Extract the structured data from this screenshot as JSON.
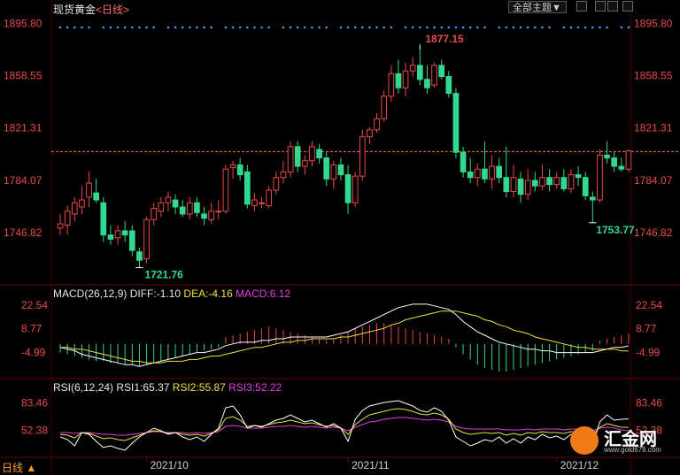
{
  "header": {
    "instrument": "现货黄金",
    "period_control": "<日线>"
  },
  "toolbar": {
    "theme_label": "全部主题▼"
  },
  "bottom": {
    "period_label": "日线 ▲"
  },
  "logo": {
    "text": "汇金网",
    "url": "www.gold678.com"
  },
  "colors": {
    "up": "#e84a4a",
    "down": "#30d890",
    "grid": "#3a0000",
    "axis_text_red": "#e84a4a",
    "diff": "#ffffff",
    "dea": "#f0e040",
    "rsi3": "#e040e0"
  },
  "chart_data": [
    {
      "type": "candlestick",
      "panel": "price",
      "yticks": [
        1895.8,
        1858.55,
        1821.31,
        1784.07,
        1746.82
      ],
      "ylim": [
        1712,
        1900
      ],
      "annotations": [
        {
          "label": "1877.15",
          "color": "#e84a4a"
        },
        {
          "label": "1721.76",
          "color": "#30d890"
        },
        {
          "label": "1753.77",
          "color": "#30d890"
        }
      ],
      "reference_line": 1804.5,
      "candles": [
        {
          "o": 1750,
          "h": 1760,
          "l": 1745,
          "c": 1753
        },
        {
          "o": 1752,
          "h": 1766,
          "l": 1745,
          "c": 1762
        },
        {
          "o": 1760,
          "h": 1772,
          "l": 1755,
          "c": 1768
        },
        {
          "o": 1765,
          "h": 1780,
          "l": 1760,
          "c": 1770
        },
        {
          "o": 1772,
          "h": 1790,
          "l": 1765,
          "c": 1782
        },
        {
          "o": 1775,
          "h": 1785,
          "l": 1768,
          "c": 1770
        },
        {
          "o": 1768,
          "h": 1772,
          "l": 1740,
          "c": 1745
        },
        {
          "o": 1745,
          "h": 1752,
          "l": 1738,
          "c": 1742
        },
        {
          "o": 1743,
          "h": 1752,
          "l": 1738,
          "c": 1748
        },
        {
          "o": 1748,
          "h": 1755,
          "l": 1740,
          "c": 1745
        },
        {
          "o": 1748,
          "h": 1752,
          "l": 1730,
          "c": 1734
        },
        {
          "o": 1733,
          "h": 1736,
          "l": 1721.76,
          "c": 1727
        },
        {
          "o": 1728,
          "h": 1758,
          "l": 1725,
          "c": 1756
        },
        {
          "o": 1756,
          "h": 1768,
          "l": 1752,
          "c": 1764
        },
        {
          "o": 1762,
          "h": 1772,
          "l": 1758,
          "c": 1768
        },
        {
          "o": 1768,
          "h": 1776,
          "l": 1762,
          "c": 1772
        },
        {
          "o": 1770,
          "h": 1774,
          "l": 1760,
          "c": 1765
        },
        {
          "o": 1765,
          "h": 1770,
          "l": 1758,
          "c": 1760
        },
        {
          "o": 1760,
          "h": 1772,
          "l": 1756,
          "c": 1768
        },
        {
          "o": 1768,
          "h": 1772,
          "l": 1758,
          "c": 1761
        },
        {
          "o": 1760,
          "h": 1765,
          "l": 1752,
          "c": 1757
        },
        {
          "o": 1756,
          "h": 1768,
          "l": 1753,
          "c": 1762
        },
        {
          "o": 1762,
          "h": 1770,
          "l": 1756,
          "c": 1762
        },
        {
          "o": 1762,
          "h": 1795,
          "l": 1760,
          "c": 1792
        },
        {
          "o": 1793,
          "h": 1798,
          "l": 1785,
          "c": 1795
        },
        {
          "o": 1795,
          "h": 1800,
          "l": 1784,
          "c": 1788
        },
        {
          "o": 1790,
          "h": 1795,
          "l": 1764,
          "c": 1767
        },
        {
          "o": 1766,
          "h": 1775,
          "l": 1762,
          "c": 1770
        },
        {
          "o": 1768,
          "h": 1772,
          "l": 1764,
          "c": 1768
        },
        {
          "o": 1766,
          "h": 1780,
          "l": 1764,
          "c": 1777
        },
        {
          "o": 1777,
          "h": 1790,
          "l": 1774,
          "c": 1786
        },
        {
          "o": 1786,
          "h": 1798,
          "l": 1782,
          "c": 1790
        },
        {
          "o": 1790,
          "h": 1812,
          "l": 1786,
          "c": 1808
        },
        {
          "o": 1808,
          "h": 1812,
          "l": 1790,
          "c": 1794
        },
        {
          "o": 1794,
          "h": 1802,
          "l": 1788,
          "c": 1798
        },
        {
          "o": 1798,
          "h": 1812,
          "l": 1794,
          "c": 1808
        },
        {
          "o": 1806,
          "h": 1810,
          "l": 1796,
          "c": 1800
        },
        {
          "o": 1800,
          "h": 1804,
          "l": 1780,
          "c": 1785
        },
        {
          "o": 1785,
          "h": 1798,
          "l": 1778,
          "c": 1795
        },
        {
          "o": 1795,
          "h": 1800,
          "l": 1784,
          "c": 1788
        },
        {
          "o": 1788,
          "h": 1795,
          "l": 1760,
          "c": 1768
        },
        {
          "o": 1768,
          "h": 1790,
          "l": 1765,
          "c": 1787
        },
        {
          "o": 1787,
          "h": 1820,
          "l": 1784,
          "c": 1815
        },
        {
          "o": 1815,
          "h": 1822,
          "l": 1810,
          "c": 1820
        },
        {
          "o": 1820,
          "h": 1832,
          "l": 1818,
          "c": 1828
        },
        {
          "o": 1828,
          "h": 1848,
          "l": 1826,
          "c": 1844
        },
        {
          "o": 1844,
          "h": 1866,
          "l": 1840,
          "c": 1860
        },
        {
          "o": 1860,
          "h": 1870,
          "l": 1846,
          "c": 1850
        },
        {
          "o": 1850,
          "h": 1868,
          "l": 1844,
          "c": 1862
        },
        {
          "o": 1862,
          "h": 1872,
          "l": 1858,
          "c": 1866
        },
        {
          "o": 1866,
          "h": 1877.15,
          "l": 1852,
          "c": 1856
        },
        {
          "o": 1856,
          "h": 1866,
          "l": 1846,
          "c": 1850
        },
        {
          "o": 1852,
          "h": 1868,
          "l": 1850,
          "c": 1866
        },
        {
          "o": 1866,
          "h": 1870,
          "l": 1856,
          "c": 1858
        },
        {
          "o": 1858,
          "h": 1862,
          "l": 1843,
          "c": 1846
        },
        {
          "o": 1846,
          "h": 1850,
          "l": 1800,
          "c": 1804
        },
        {
          "o": 1804,
          "h": 1808,
          "l": 1786,
          "c": 1790
        },
        {
          "o": 1790,
          "h": 1800,
          "l": 1782,
          "c": 1786
        },
        {
          "o": 1786,
          "h": 1796,
          "l": 1780,
          "c": 1792
        },
        {
          "o": 1792,
          "h": 1812,
          "l": 1782,
          "c": 1785
        },
        {
          "o": 1785,
          "h": 1802,
          "l": 1778,
          "c": 1794
        },
        {
          "o": 1794,
          "h": 1800,
          "l": 1782,
          "c": 1786
        },
        {
          "o": 1786,
          "h": 1808,
          "l": 1772,
          "c": 1776
        },
        {
          "o": 1776,
          "h": 1795,
          "l": 1772,
          "c": 1786
        },
        {
          "o": 1785,
          "h": 1790,
          "l": 1768,
          "c": 1774
        },
        {
          "o": 1774,
          "h": 1792,
          "l": 1770,
          "c": 1784
        },
        {
          "o": 1784,
          "h": 1790,
          "l": 1776,
          "c": 1780
        },
        {
          "o": 1780,
          "h": 1795,
          "l": 1777,
          "c": 1786
        },
        {
          "o": 1786,
          "h": 1792,
          "l": 1776,
          "c": 1781
        },
        {
          "o": 1781,
          "h": 1790,
          "l": 1778,
          "c": 1786
        },
        {
          "o": 1786,
          "h": 1792,
          "l": 1776,
          "c": 1778
        },
        {
          "o": 1778,
          "h": 1792,
          "l": 1775,
          "c": 1788
        },
        {
          "o": 1788,
          "h": 1794,
          "l": 1780,
          "c": 1786
        },
        {
          "o": 1786,
          "h": 1790,
          "l": 1770,
          "c": 1773
        },
        {
          "o": 1772,
          "h": 1776,
          "l": 1753.77,
          "c": 1770
        },
        {
          "o": 1770,
          "h": 1806,
          "l": 1768,
          "c": 1802
        },
        {
          "o": 1802,
          "h": 1812,
          "l": 1796,
          "c": 1800
        },
        {
          "o": 1800,
          "h": 1804,
          "l": 1790,
          "c": 1794
        },
        {
          "o": 1794,
          "h": 1800,
          "l": 1790,
          "c": 1792
        },
        {
          "o": 1792,
          "h": 1806,
          "l": 1790,
          "c": 1805
        }
      ],
      "markers_on_top": true
    },
    {
      "type": "bar+line",
      "panel": "macd",
      "title": "MACD(26,12,9)",
      "diff_label": "DIFF:-1.10",
      "dea_label": "DEA:-4.16",
      "macd_label": "MACD:6.12",
      "yticks": [
        22.54,
        8.77,
        -4.99
      ],
      "ylim": [
        -18,
        26
      ],
      "macd_hist": [
        -5,
        -6,
        -7,
        -8,
        -9,
        -10,
        -10,
        -11,
        -11,
        -12,
        -12,
        -13,
        -12,
        -11,
        -10,
        -9,
        -8,
        -7,
        -6,
        -5,
        -4,
        -3,
        -2,
        4,
        5,
        6,
        7,
        8,
        9,
        10,
        9,
        8,
        7,
        6,
        5,
        4,
        3,
        2,
        3,
        5,
        7,
        9,
        10,
        11,
        12,
        12,
        11,
        10,
        9,
        8,
        7,
        6,
        5,
        4,
        3,
        -2,
        -6,
        -9,
        -12,
        -14,
        -15,
        -16,
        -16,
        -15,
        -14,
        -13,
        -12,
        -11,
        -10,
        -9,
        -8,
        -7,
        -6,
        -5,
        -4,
        2,
        3,
        4,
        5,
        6
      ],
      "diff": [
        -2,
        -3,
        -4,
        -6,
        -7,
        -8,
        -9,
        -10,
        -11,
        -12,
        -12,
        -13,
        -12,
        -11,
        -10,
        -9,
        -8,
        -7,
        -6,
        -5,
        -5,
        -4,
        -3,
        -1,
        0,
        1,
        1,
        1,
        2,
        2,
        3,
        3,
        4,
        4,
        4,
        4,
        4,
        4,
        5,
        6,
        7,
        9,
        11,
        13,
        15,
        17,
        19,
        21,
        22,
        23,
        23,
        23,
        22,
        21,
        20,
        17,
        13,
        10,
        7,
        5,
        3,
        1,
        0,
        -1,
        -2,
        -3,
        -3,
        -4,
        -4,
        -5,
        -5,
        -5,
        -5,
        -5,
        -5,
        -4,
        -3,
        -2,
        -2,
        -1.1
      ],
      "dea": [
        -2,
        -2,
        -3,
        -3,
        -4,
        -5,
        -6,
        -7,
        -8,
        -9,
        -10,
        -10,
        -11,
        -11,
        -11,
        -10,
        -10,
        -10,
        -9,
        -9,
        -8,
        -7,
        -7,
        -6,
        -5,
        -4,
        -3,
        -2,
        -2,
        -1,
        0,
        1,
        1,
        2,
        2,
        3,
        3,
        3,
        3,
        4,
        4,
        5,
        6,
        7,
        8,
        9,
        11,
        12,
        14,
        15,
        16,
        17,
        18,
        19,
        19,
        19,
        18,
        17,
        16,
        14,
        13,
        11,
        10,
        8,
        7,
        6,
        4,
        3,
        2,
        1,
        0,
        -1,
        -2,
        -2,
        -3,
        -3,
        -3,
        -3,
        -4,
        -4.16
      ]
    },
    {
      "type": "line",
      "panel": "rsi",
      "title": "RSI(6,12,24)",
      "rsi1_label": "RSI1:65.37",
      "rsi2_label": "RSI2:55.87",
      "rsi3_label": "RSI3:52.22",
      "yticks": [
        83.46,
        52.38
      ],
      "ylim": [
        25,
        95
      ],
      "rsi1": [
        45,
        42,
        35,
        50,
        48,
        40,
        33,
        35,
        32,
        30,
        38,
        45,
        50,
        55,
        52,
        48,
        50,
        45,
        42,
        45,
        40,
        48,
        55,
        78,
        80,
        70,
        55,
        58,
        56,
        60,
        64,
        66,
        70,
        66,
        62,
        64,
        60,
        56,
        60,
        55,
        40,
        65,
        75,
        80,
        82,
        84,
        85,
        86,
        83,
        80,
        75,
        73,
        78,
        74,
        64,
        45,
        40,
        35,
        38,
        42,
        40,
        45,
        38,
        43,
        38,
        45,
        42,
        48,
        44,
        46,
        42,
        48,
        46,
        40,
        36,
        62,
        70,
        64,
        65,
        65.37
      ],
      "rsi2": [
        48,
        47,
        44,
        50,
        49,
        46,
        43,
        44,
        42,
        41,
        44,
        47,
        50,
        52,
        51,
        49,
        50,
        48,
        47,
        48,
        46,
        49,
        53,
        66,
        68,
        64,
        57,
        58,
        57,
        59,
        61,
        62,
        64,
        62,
        60,
        61,
        59,
        57,
        58,
        55,
        48,
        59,
        65,
        70,
        72,
        74,
        76,
        77,
        76,
        74,
        71,
        70,
        72,
        70,
        65,
        54,
        50,
        48,
        49,
        50,
        49,
        50,
        47,
        49,
        47,
        50,
        49,
        51,
        50,
        50,
        49,
        51,
        50,
        48,
        47,
        56,
        60,
        58,
        56,
        55.87
      ],
      "rsi3": [
        50,
        50,
        49,
        50,
        50,
        49,
        48,
        48,
        47,
        47,
        48,
        49,
        50,
        51,
        51,
        50,
        50,
        50,
        49,
        50,
        49,
        50,
        51,
        57,
        58,
        57,
        55,
        55,
        55,
        56,
        57,
        57,
        58,
        57,
        56,
        57,
        56,
        55,
        56,
        55,
        52,
        56,
        59,
        62,
        63,
        65,
        66,
        67,
        67,
        66,
        65,
        64,
        65,
        64,
        62,
        57,
        55,
        54,
        54,
        54,
        54,
        54,
        53,
        53,
        53,
        54,
        53,
        54,
        54,
        54,
        53,
        54,
        54,
        53,
        52,
        55,
        56,
        55,
        53,
        52.22
      ]
    },
    {
      "type": "axis",
      "panel": "time",
      "labels": [
        "2021/10",
        "2021/11",
        "2021/12"
      ],
      "label_index": [
        12,
        40,
        69
      ]
    }
  ]
}
